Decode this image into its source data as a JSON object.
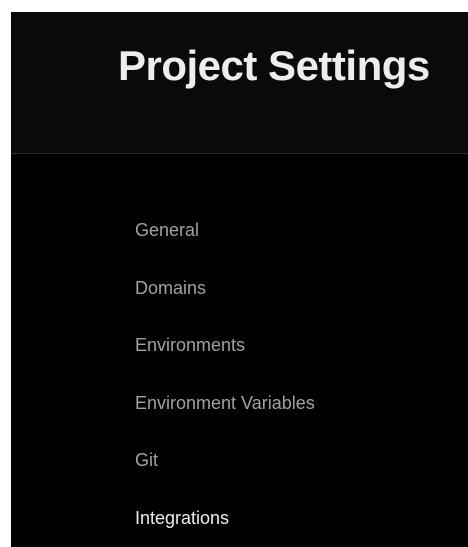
{
  "header": {
    "title": "Project Settings"
  },
  "nav": {
    "items": [
      {
        "label": "General"
      },
      {
        "label": "Domains"
      },
      {
        "label": "Environments"
      },
      {
        "label": "Environment Variables"
      },
      {
        "label": "Git"
      },
      {
        "label": "Integrations"
      }
    ],
    "active": "Integrations"
  },
  "colors": {
    "background": "#000000",
    "header_background": "#0a0a0a",
    "title_text": "#ededed",
    "nav_text": "#a1a1a1",
    "nav_active_text": "#ededed",
    "divider": "#2a2a2a"
  }
}
